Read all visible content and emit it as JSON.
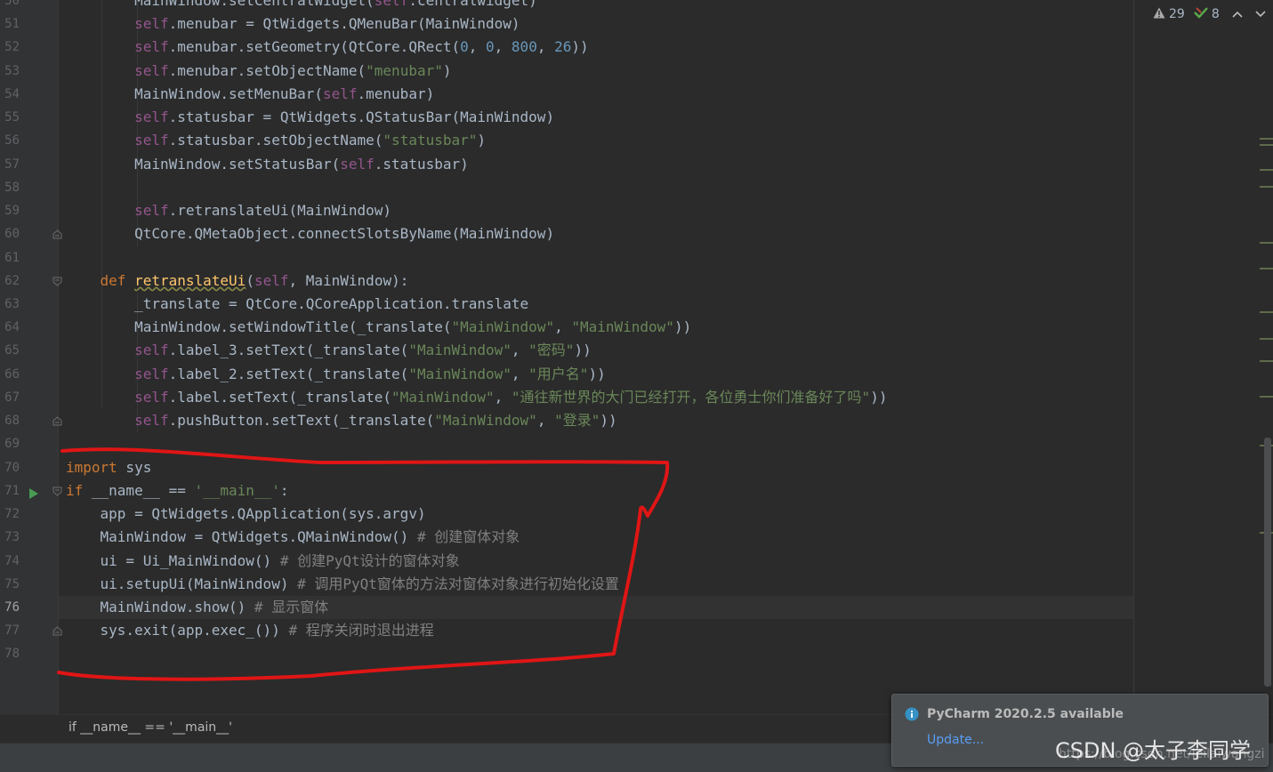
{
  "gutter": {
    "line_numbers": [
      "50",
      "51",
      "52",
      "53",
      "54",
      "55",
      "56",
      "57",
      "58",
      "59",
      "60",
      "61",
      "62",
      "63",
      "64",
      "65",
      "66",
      "67",
      "68",
      "69",
      "70",
      "71",
      "72",
      "73",
      "74",
      "75",
      "76",
      "77",
      "78"
    ],
    "current_line": "76"
  },
  "code": {
    "lines": [
      "        MainWindow.setCentralWidget(self.centralwidget)",
      "        self.menubar = QtWidgets.QMenuBar(MainWindow)",
      "        self.menubar.setGeometry(QtCore.QRect(0, 0, 800, 26))",
      "        self.menubar.setObjectName(\"menubar\")",
      "        MainWindow.setMenuBar(self.menubar)",
      "        self.statusbar = QtWidgets.QStatusBar(MainWindow)",
      "        self.statusbar.setObjectName(\"statusbar\")",
      "        MainWindow.setStatusBar(self.statusbar)",
      "",
      "        self.retranslateUi(MainWindow)",
      "        QtCore.QMetaObject.connectSlotsByName(MainWindow)",
      "",
      "    def retranslateUi(self, MainWindow):",
      "        _translate = QtCore.QCoreApplication.translate",
      "        MainWindow.setWindowTitle(_translate(\"MainWindow\", \"MainWindow\"))",
      "        self.label_3.setText(_translate(\"MainWindow\", \"密码\"))",
      "        self.label_2.setText(_translate(\"MainWindow\", \"用户名\"))",
      "        self.label.setText(_translate(\"MainWindow\", \"通往新世界的大门已经打开，各位勇士你们准备好了吗\"))",
      "        self.pushButton.setText(_translate(\"MainWindow\", \"登录\"))",
      "",
      "import sys",
      "if __name__ == '__main__':",
      "    app = QtWidgets.QApplication(sys.argv)",
      "    MainWindow = QtWidgets.QMainWindow() # 创建窗体对象",
      "    ui = Ui_MainWindow() # 创建PyQt设计的窗体对象",
      "    ui.setupUi(MainWindow) # 调用PyQt窗体的方法对窗体对象进行初始化设置",
      "    MainWindow.show() # 显示窗体",
      "    sys.exit(app.exec_()) # 程序关闭时退出进程",
      ""
    ]
  },
  "inspection": {
    "warnings_count": "29",
    "weak_warnings_count": "8",
    "warning_icon": "warning-triangle-icon",
    "check_icon": "check-icon"
  },
  "breadcrumb": "if __name__ == '__main__'",
  "notification": {
    "title": "PyCharm 2020.2.5 available",
    "link": "Update...",
    "icon": "info-icon"
  },
  "watermark": {
    "text": "CSDN @太子李同学",
    "url": "https://blog.csdn.net/leilaiwangzi"
  },
  "colors": {
    "editor_bg": "#2b2b2b",
    "keyword": "#cc7832",
    "self": "#94558d",
    "string": "#6a8759",
    "number": "#6897bb",
    "function_def": "#ffc66d",
    "comment": "#808080",
    "annotation_red": "#e01515",
    "link": "#589df6"
  }
}
